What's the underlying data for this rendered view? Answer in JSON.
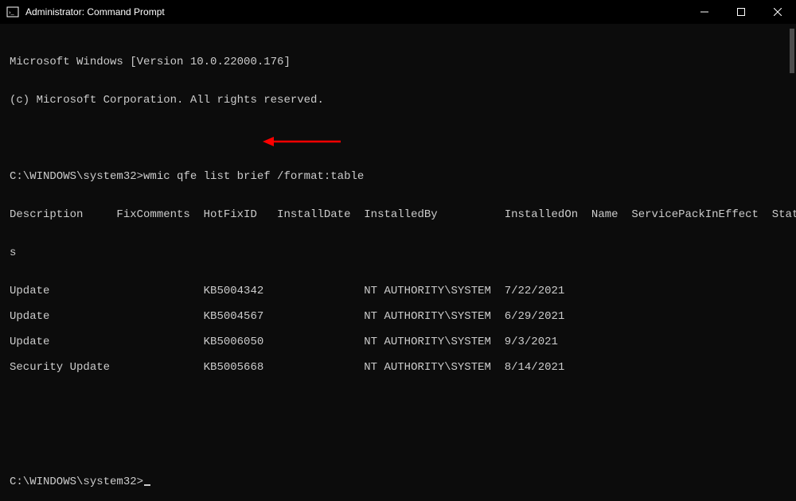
{
  "window": {
    "title": "Administrator: Command Prompt"
  },
  "banner": {
    "version_line": "Microsoft Windows [Version 10.0.22000.176]",
    "copyright_line": "(c) Microsoft Corporation. All rights reserved."
  },
  "prompt1": {
    "path": "C:\\WINDOWS\\system32>",
    "command": "wmic qfe list brief /format:table"
  },
  "header": {
    "line1": "Description     FixComments  HotFixID   InstallDate  InstalledBy          InstalledOn  Name  ServicePackInEffect  Statu",
    "wrap": "s"
  },
  "rows": [
    {
      "description": "Update",
      "hotfix": "KB5004342",
      "installed_by": "NT AUTHORITY\\SYSTEM",
      "installed_on": "7/22/2021"
    },
    {
      "description": "Update",
      "hotfix": "KB5004567",
      "installed_by": "NT AUTHORITY\\SYSTEM",
      "installed_on": "6/29/2021"
    },
    {
      "description": "Update",
      "hotfix": "KB5006050",
      "installed_by": "NT AUTHORITY\\SYSTEM",
      "installed_on": "9/3/2021"
    },
    {
      "description": "Security Update",
      "hotfix": "KB5005668",
      "installed_by": "NT AUTHORITY\\SYSTEM",
      "installed_on": "8/14/2021"
    }
  ],
  "prompt2": {
    "path": "C:\\WINDOWS\\system32>"
  },
  "annotation": {
    "arrow_color": "#ff0000",
    "target_hotfix": "KB5004567"
  }
}
